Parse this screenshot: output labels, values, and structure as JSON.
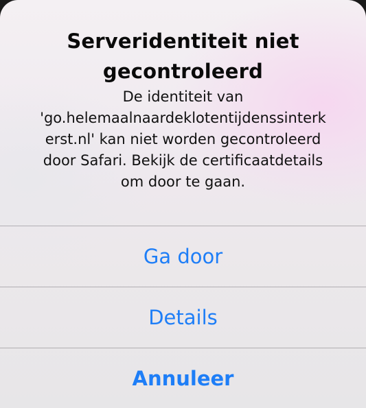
{
  "alert": {
    "title_line1": "Serveridentiteit niet",
    "title_line2": "gecontroleerd",
    "message_lines": [
      "De identiteit van",
      "'go.helemaalnaardeklotentijdenssinterk",
      "erst.nl' kan niet worden gecontroleerd",
      "door Safari. Bekijk de certificaatdetails",
      "om door te gaan."
    ],
    "actions": {
      "continue_label": "Ga door",
      "details_label": "Details",
      "cancel_label": "Annuleer"
    },
    "accent_color": "#1e7ef7"
  }
}
